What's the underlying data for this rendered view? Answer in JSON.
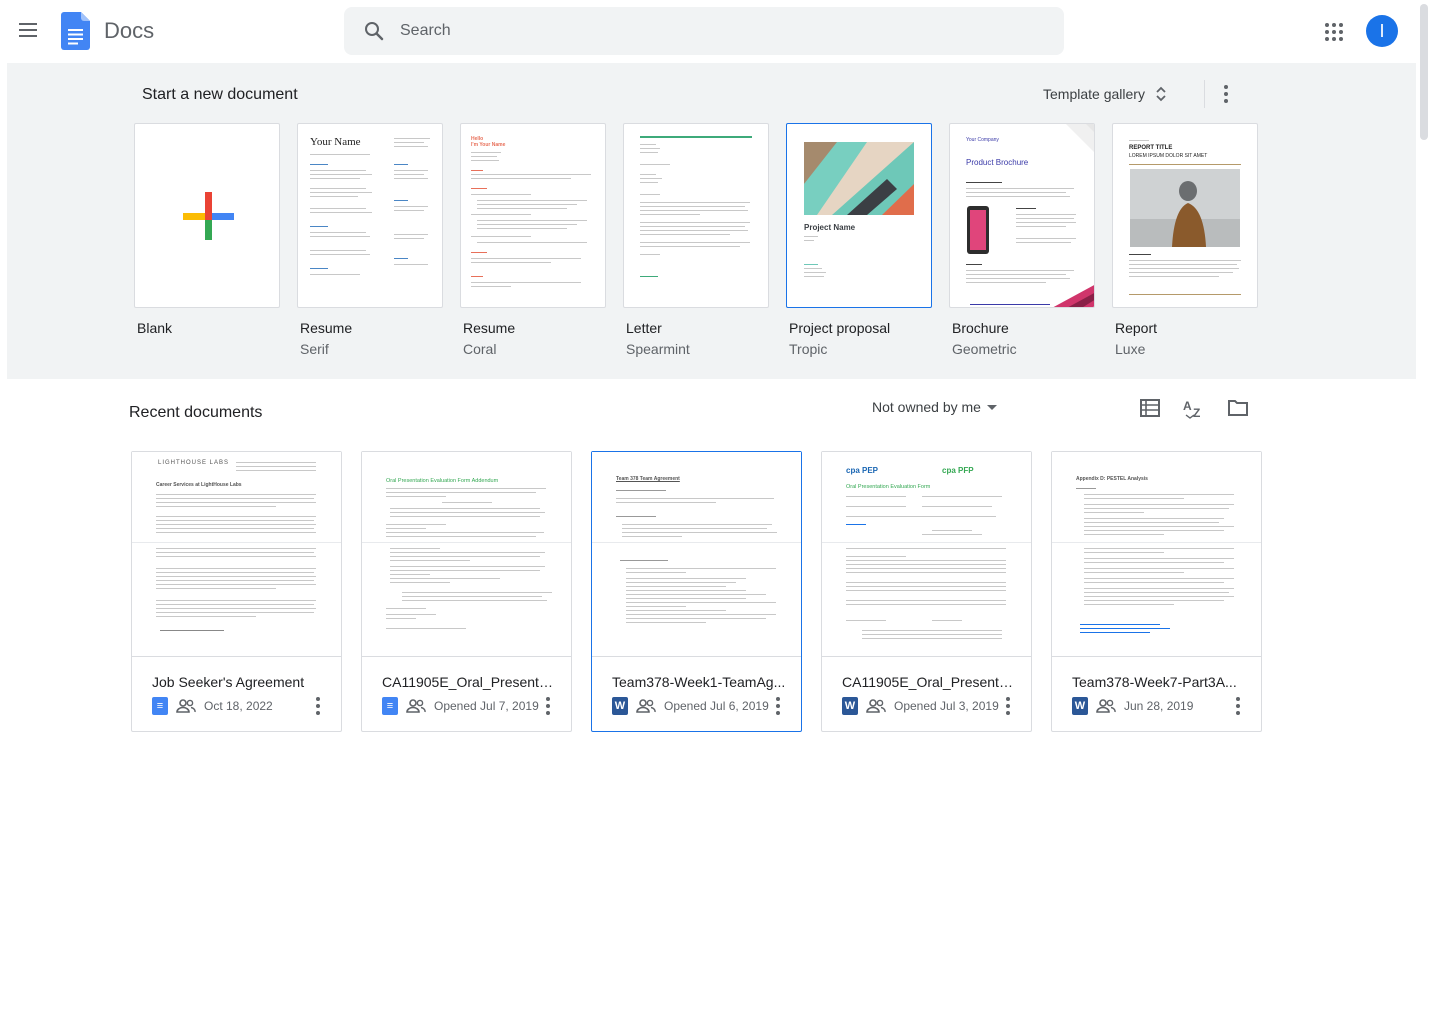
{
  "header": {
    "app_title": "Docs",
    "search_placeholder": "Search",
    "avatar_initial": "I",
    "icons": [
      "menu-icon",
      "docs-logo-icon",
      "search-icon",
      "apps-icon"
    ]
  },
  "templates": {
    "section_title": "Start a new document",
    "gallery_label": "Template gallery",
    "items": [
      {
        "name": "Blank",
        "sub": ""
      },
      {
        "name": "Resume",
        "sub": "Serif",
        "preview_title": "Your Name"
      },
      {
        "name": "Resume",
        "sub": "Coral",
        "preview_title": "Hello\nI'm Your Name"
      },
      {
        "name": "Letter",
        "sub": "Spearmint"
      },
      {
        "name": "Project proposal",
        "sub": "Tropic",
        "preview_title": "Project Name"
      },
      {
        "name": "Brochure",
        "sub": "Geometric",
        "preview_title": "Product Brochure",
        "preview_kicker": "Your Company"
      },
      {
        "name": "Report",
        "sub": "Luxe",
        "preview_title": "REPORT TITLE",
        "preview_sub": "LOREM IPSUM DOLOR SIT AMET"
      }
    ]
  },
  "recent": {
    "title": "Recent documents",
    "owner_filter": "Not owned by me",
    "view_icons": [
      "list-view-icon",
      "sort-az-icon",
      "folder-icon"
    ],
    "docs": [
      {
        "title": "Job Seeker's Agreement",
        "type": "gdoc",
        "date": "Oct 18, 2022",
        "preview_heading": "Career Services at LightHouse Labs",
        "preview_logo": "LIGHTHOUSE LABS"
      },
      {
        "title": "CA11905E_Oral_Presenta...",
        "type": "gdoc",
        "date": "Opened Jul 7, 2019",
        "preview_heading": "Oral Presentation Evaluation Form Addendum"
      },
      {
        "title": "Team378-Week1-TeamAg...",
        "type": "word",
        "date": "Opened Jul 6, 2019",
        "preview_heading": "Team 378 Team Agreement",
        "selected": true
      },
      {
        "title": "CA11905E_Oral_Presenta...",
        "type": "word",
        "date": "Opened Jul 3, 2019",
        "preview_heading": "Oral Presentation Evaluation Form",
        "preview_logo": "cpa PEP"
      },
      {
        "title": "Team378-Week7-Part3A...",
        "type": "word",
        "date": "Jun 28, 2019",
        "preview_heading": "Appendix D: PESTEL Analysis"
      }
    ]
  },
  "colors": {
    "accent": "#1a73e8",
    "docs_blue": "#4285f4",
    "word_blue": "#2b5797",
    "panel_bg": "#f1f3f4"
  }
}
